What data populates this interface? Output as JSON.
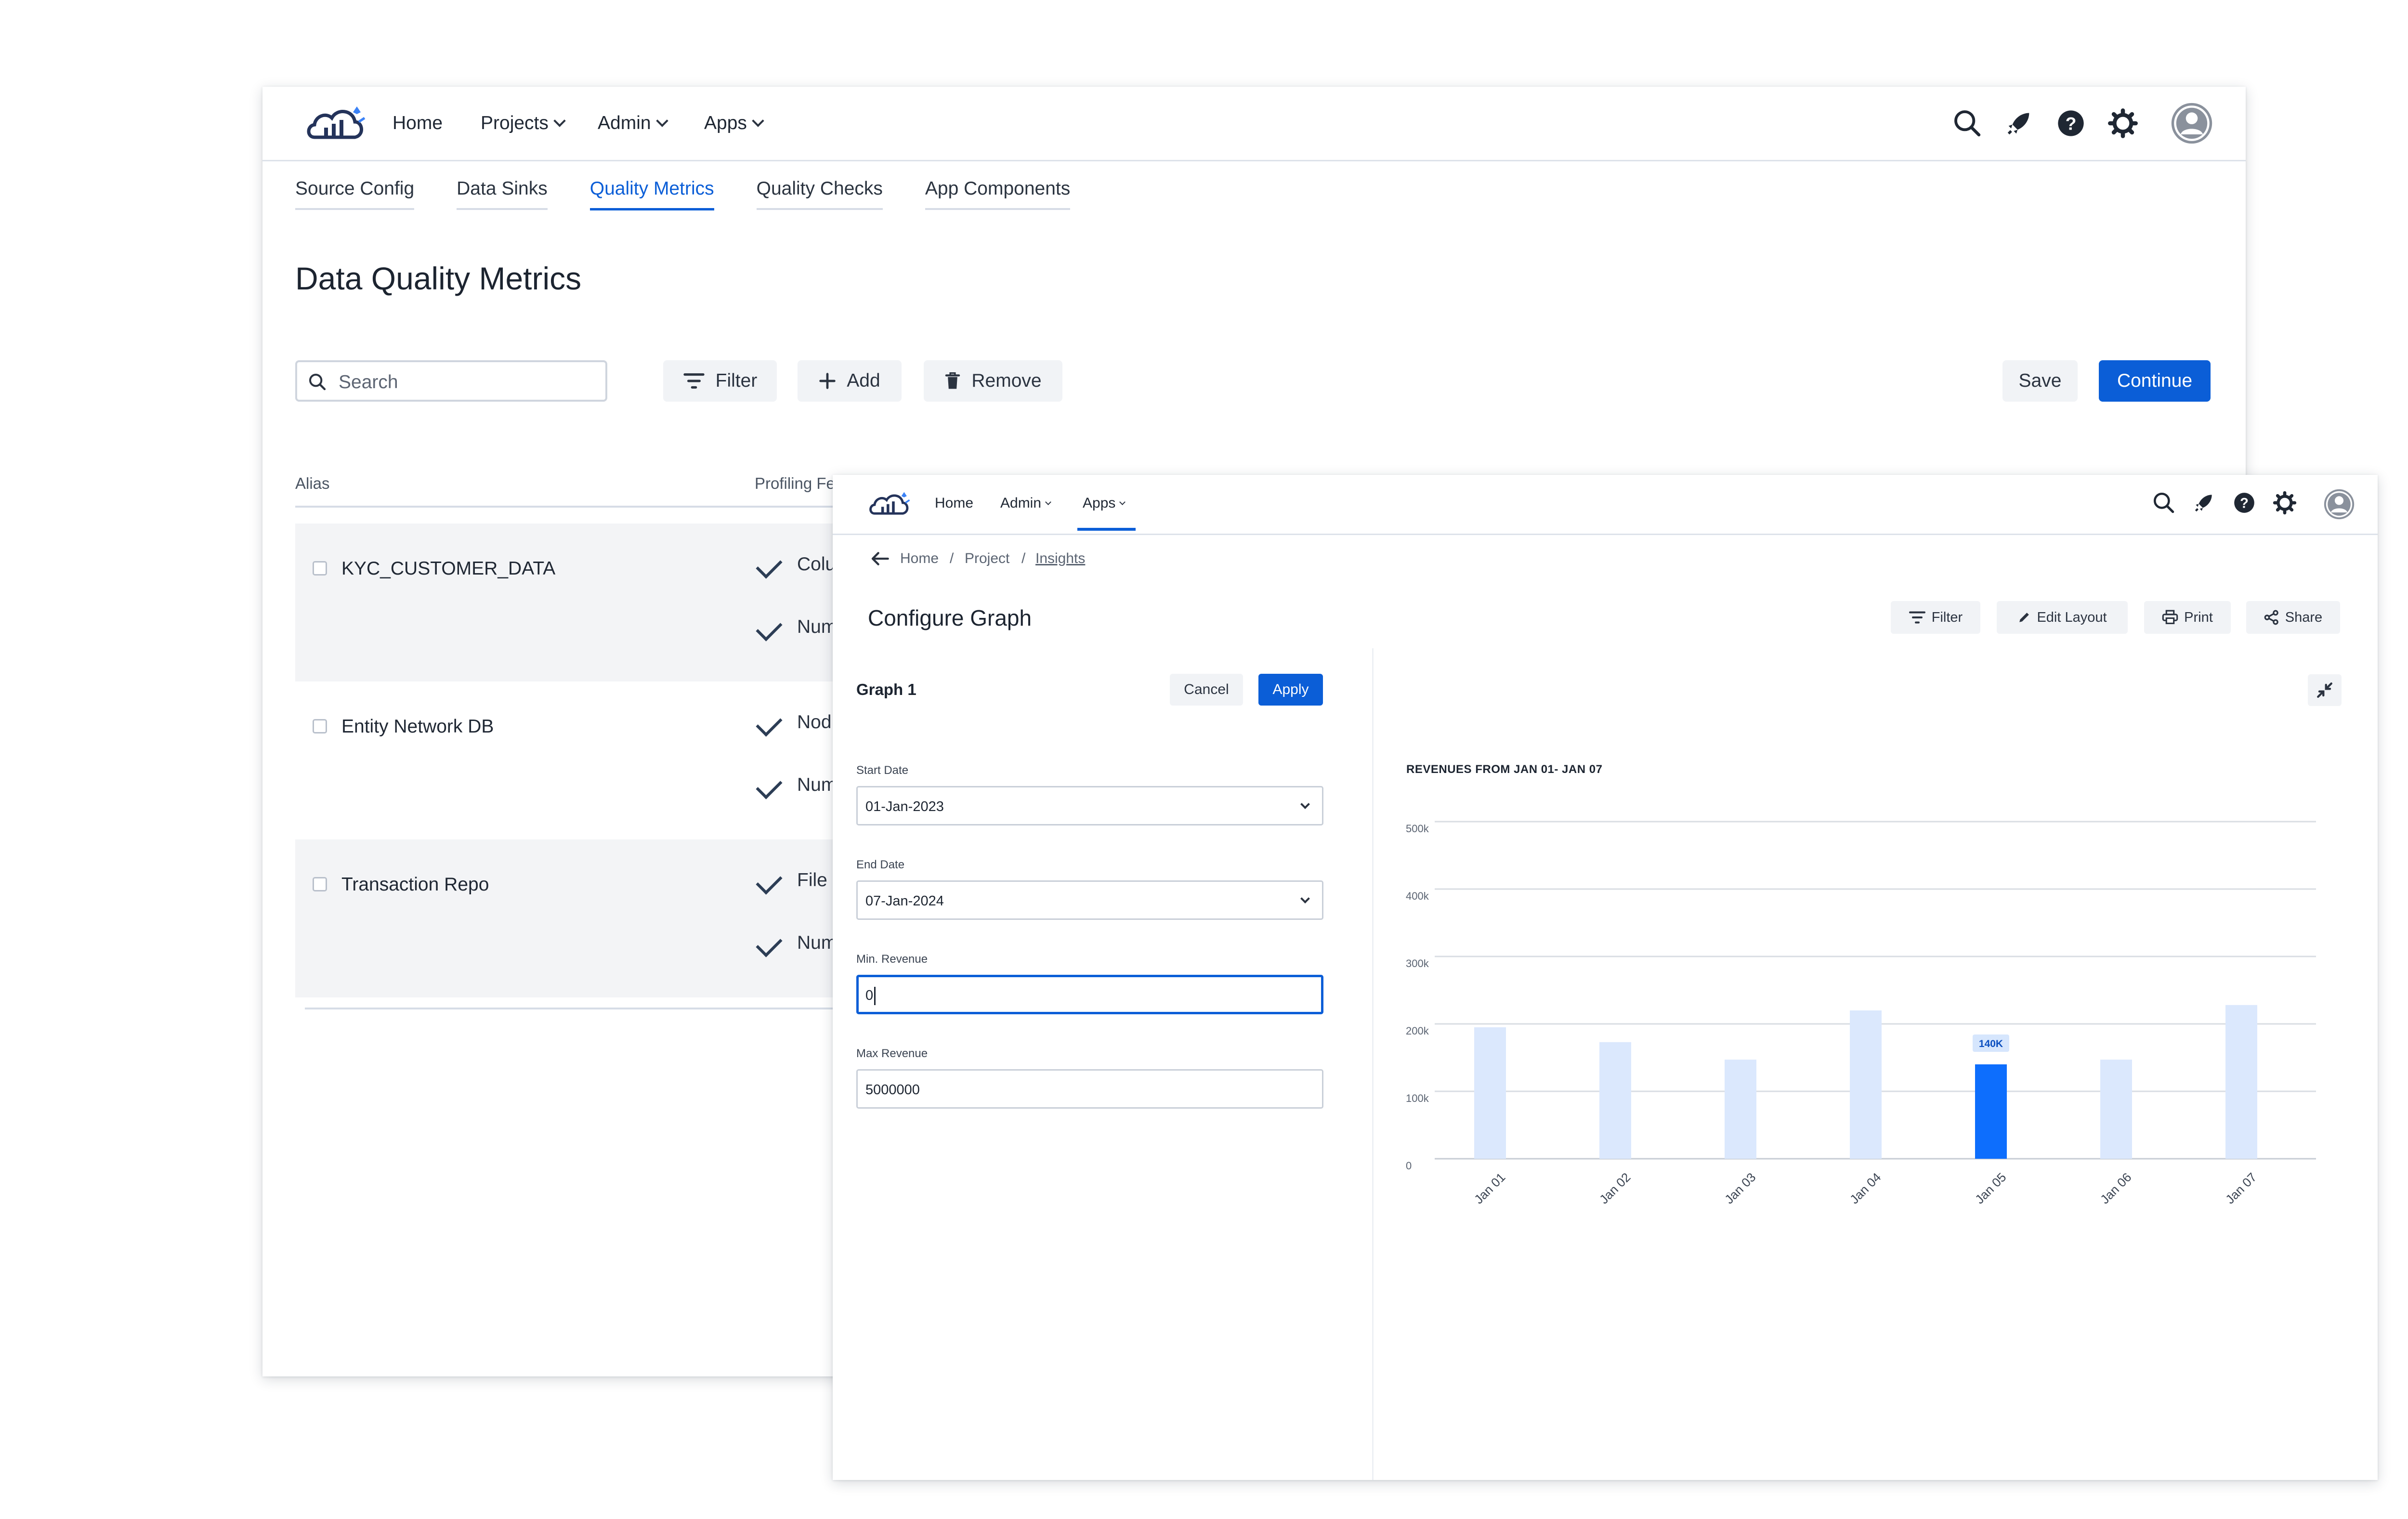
{
  "back_window": {
    "nav": {
      "home": "Home",
      "projects": "Projects",
      "admin": "Admin",
      "apps": "Apps"
    },
    "tabs": [
      "Source Config",
      "Data Sinks",
      "Quality Metrics",
      "Quality Checks",
      "App Components"
    ],
    "active_tab": "Quality Metrics",
    "title": "Data Quality Metrics",
    "search_placeholder": "Search",
    "buttons": {
      "filter": "Filter",
      "add": "Add",
      "remove": "Remove",
      "save": "Save",
      "continue": "Continue"
    },
    "table": {
      "headers": {
        "alias": "Alias",
        "profiling": "Profiling Fe"
      },
      "rows": [
        {
          "alias": "KYC_CUSTOMER_DATA",
          "items": [
            "Colu",
            "Num"
          ]
        },
        {
          "alias": "Entity Network DB",
          "items": [
            "Nod",
            "Num"
          ]
        },
        {
          "alias": "Transaction Repo",
          "items": [
            "File",
            "Num"
          ]
        }
      ]
    }
  },
  "front_window": {
    "nav": {
      "home": "Home",
      "admin": "Admin",
      "apps": "Apps"
    },
    "breadcrumb": {
      "home": "Home",
      "project": "Project",
      "current": "Insights",
      "separator": "/"
    },
    "title": "Configure Graph",
    "toolbar": {
      "filter": "Filter",
      "edit_layout": "Edit Layout",
      "print": "Print",
      "share": "Share"
    },
    "form": {
      "graph_name": "Graph 1",
      "cancel": "Cancel",
      "apply": "Apply",
      "start_date_label": "Start Date",
      "start_date": "01-Jan-2023",
      "end_date_label": "End Date",
      "end_date": "07-Jan-2024",
      "min_revenue_label": "Min. Revenue",
      "min_revenue": "0",
      "max_revenue_label": "Max Revenue",
      "max_revenue": "5000000"
    },
    "chart_title": "REVENUES FROM JAN 01- JAN 07"
  },
  "colors": {
    "accent": "#0b5ed7",
    "bar_light": "#dbe8fd",
    "bar_highlight": "#0d6efd"
  },
  "chart_data": {
    "type": "bar",
    "title": "REVENUES FROM JAN 01- JAN 07",
    "categories": [
      "Jan 01",
      "Jan 02",
      "Jan 03",
      "Jan 04",
      "Jan 05",
      "Jan 06",
      "Jan 07"
    ],
    "values": [
      195000,
      173000,
      147000,
      220000,
      140000,
      147000,
      228000
    ],
    "highlight_index": 4,
    "highlight_label": "140K",
    "yticks": [
      0,
      100000,
      200000,
      300000,
      400000,
      500000
    ],
    "ytick_labels": [
      "0",
      "100k",
      "200k",
      "300k",
      "400k",
      "500k"
    ],
    "ylim": [
      0,
      500000
    ],
    "grid": true
  }
}
